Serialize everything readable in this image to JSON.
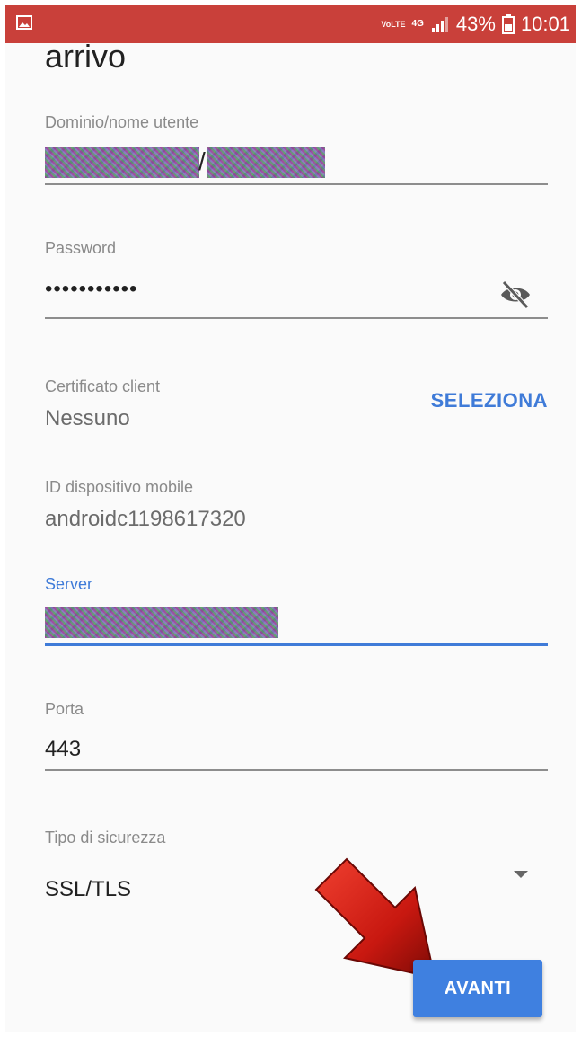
{
  "status_bar": {
    "volte": "VoLTE",
    "network": "4G",
    "battery": "43%",
    "time": "10:01",
    "background_color": "#c9403a"
  },
  "page": {
    "title": "arrivo"
  },
  "fields": {
    "domain_user": {
      "label": "Dominio/nome utente",
      "separator": "/"
    },
    "password": {
      "label": "Password",
      "value": "•••••••••••"
    },
    "client_certificate": {
      "label": "Certificato client",
      "value": "Nessuno",
      "action": "SELEZIONA"
    },
    "device_id": {
      "label": "ID dispositivo mobile",
      "value": "androidc1198617320"
    },
    "server": {
      "label": "Server"
    },
    "port": {
      "label": "Porta",
      "value": "443"
    },
    "security_type": {
      "label": "Tipo di sicurezza",
      "value": "SSL/TLS"
    }
  },
  "actions": {
    "next_label": "AVANTI"
  },
  "colors": {
    "accent": "#3f7bd8",
    "button": "#3f80e0",
    "overlay_arrow": "#c81810"
  }
}
